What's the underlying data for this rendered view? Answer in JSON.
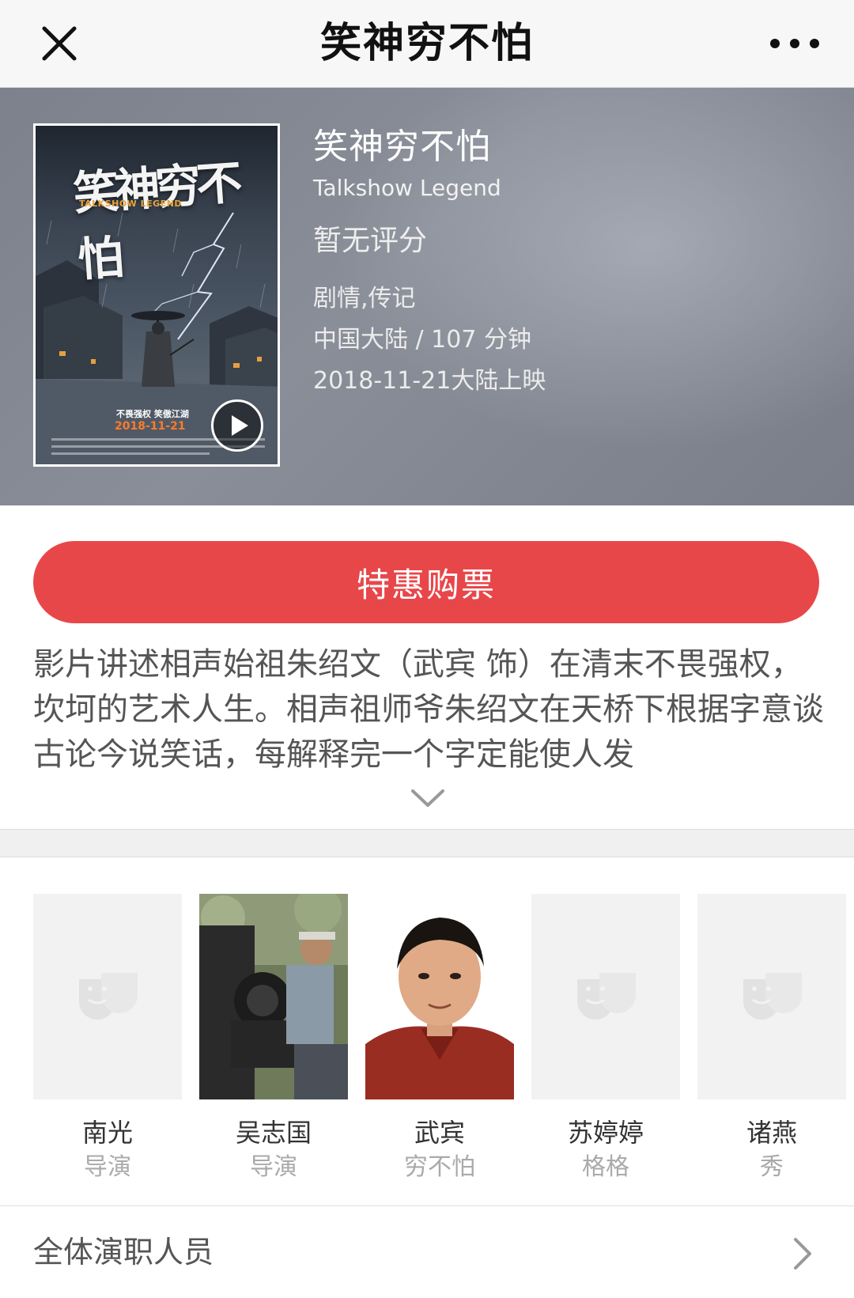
{
  "nav": {
    "title": "笑神穷不怕",
    "close_icon": "close-icon",
    "more_icon": "more-horizontal-icon"
  },
  "movie": {
    "title": "笑神穷不怕",
    "english_title": "Talkshow Legend",
    "rating": "暂无评分",
    "genres": "剧情,传记",
    "region_duration": "中国大陆 / 107 分钟",
    "release": "2018-11-21大陆上映"
  },
  "poster": {
    "title_art": "笑神穷不怕",
    "english_art": "TALKSHOW LEGEND",
    "slogan": "不畏强权  笑傲江湖",
    "date": "2018-11-21",
    "play_icon": "play-icon"
  },
  "ticket_button": {
    "label": "特惠购票"
  },
  "synopsis": {
    "text": "影片讲述相声始祖朱绍文（武宾 饰）在清末不畏强权，坎坷的艺术人生。相声祖师爷朱绍文在天桥下根据字意谈古论今说笑话，每解释完一个字定能使人发",
    "expand_icon": "chevron-down-icon"
  },
  "cast": [
    {
      "name": "南光",
      "role": "导演",
      "photo": "placeholder-mask-icon"
    },
    {
      "name": "吴志国",
      "role": "导演",
      "photo": "camera-operator-photo"
    },
    {
      "name": "武宾",
      "role": "穷不怕",
      "photo": "actor-portrait-photo"
    },
    {
      "name": "苏婷婷",
      "role": "格格",
      "photo": "placeholder-mask-icon"
    },
    {
      "name": "诸燕",
      "role": "秀",
      "photo": "placeholder-mask-icon"
    }
  ],
  "all_cast": {
    "label": "全体演职人员",
    "arrow_icon": "chevron-right-icon"
  },
  "colors": {
    "accent": "#e8474a",
    "hero_bg": "#80848e",
    "navbar_bg": "#f7f7f7"
  }
}
